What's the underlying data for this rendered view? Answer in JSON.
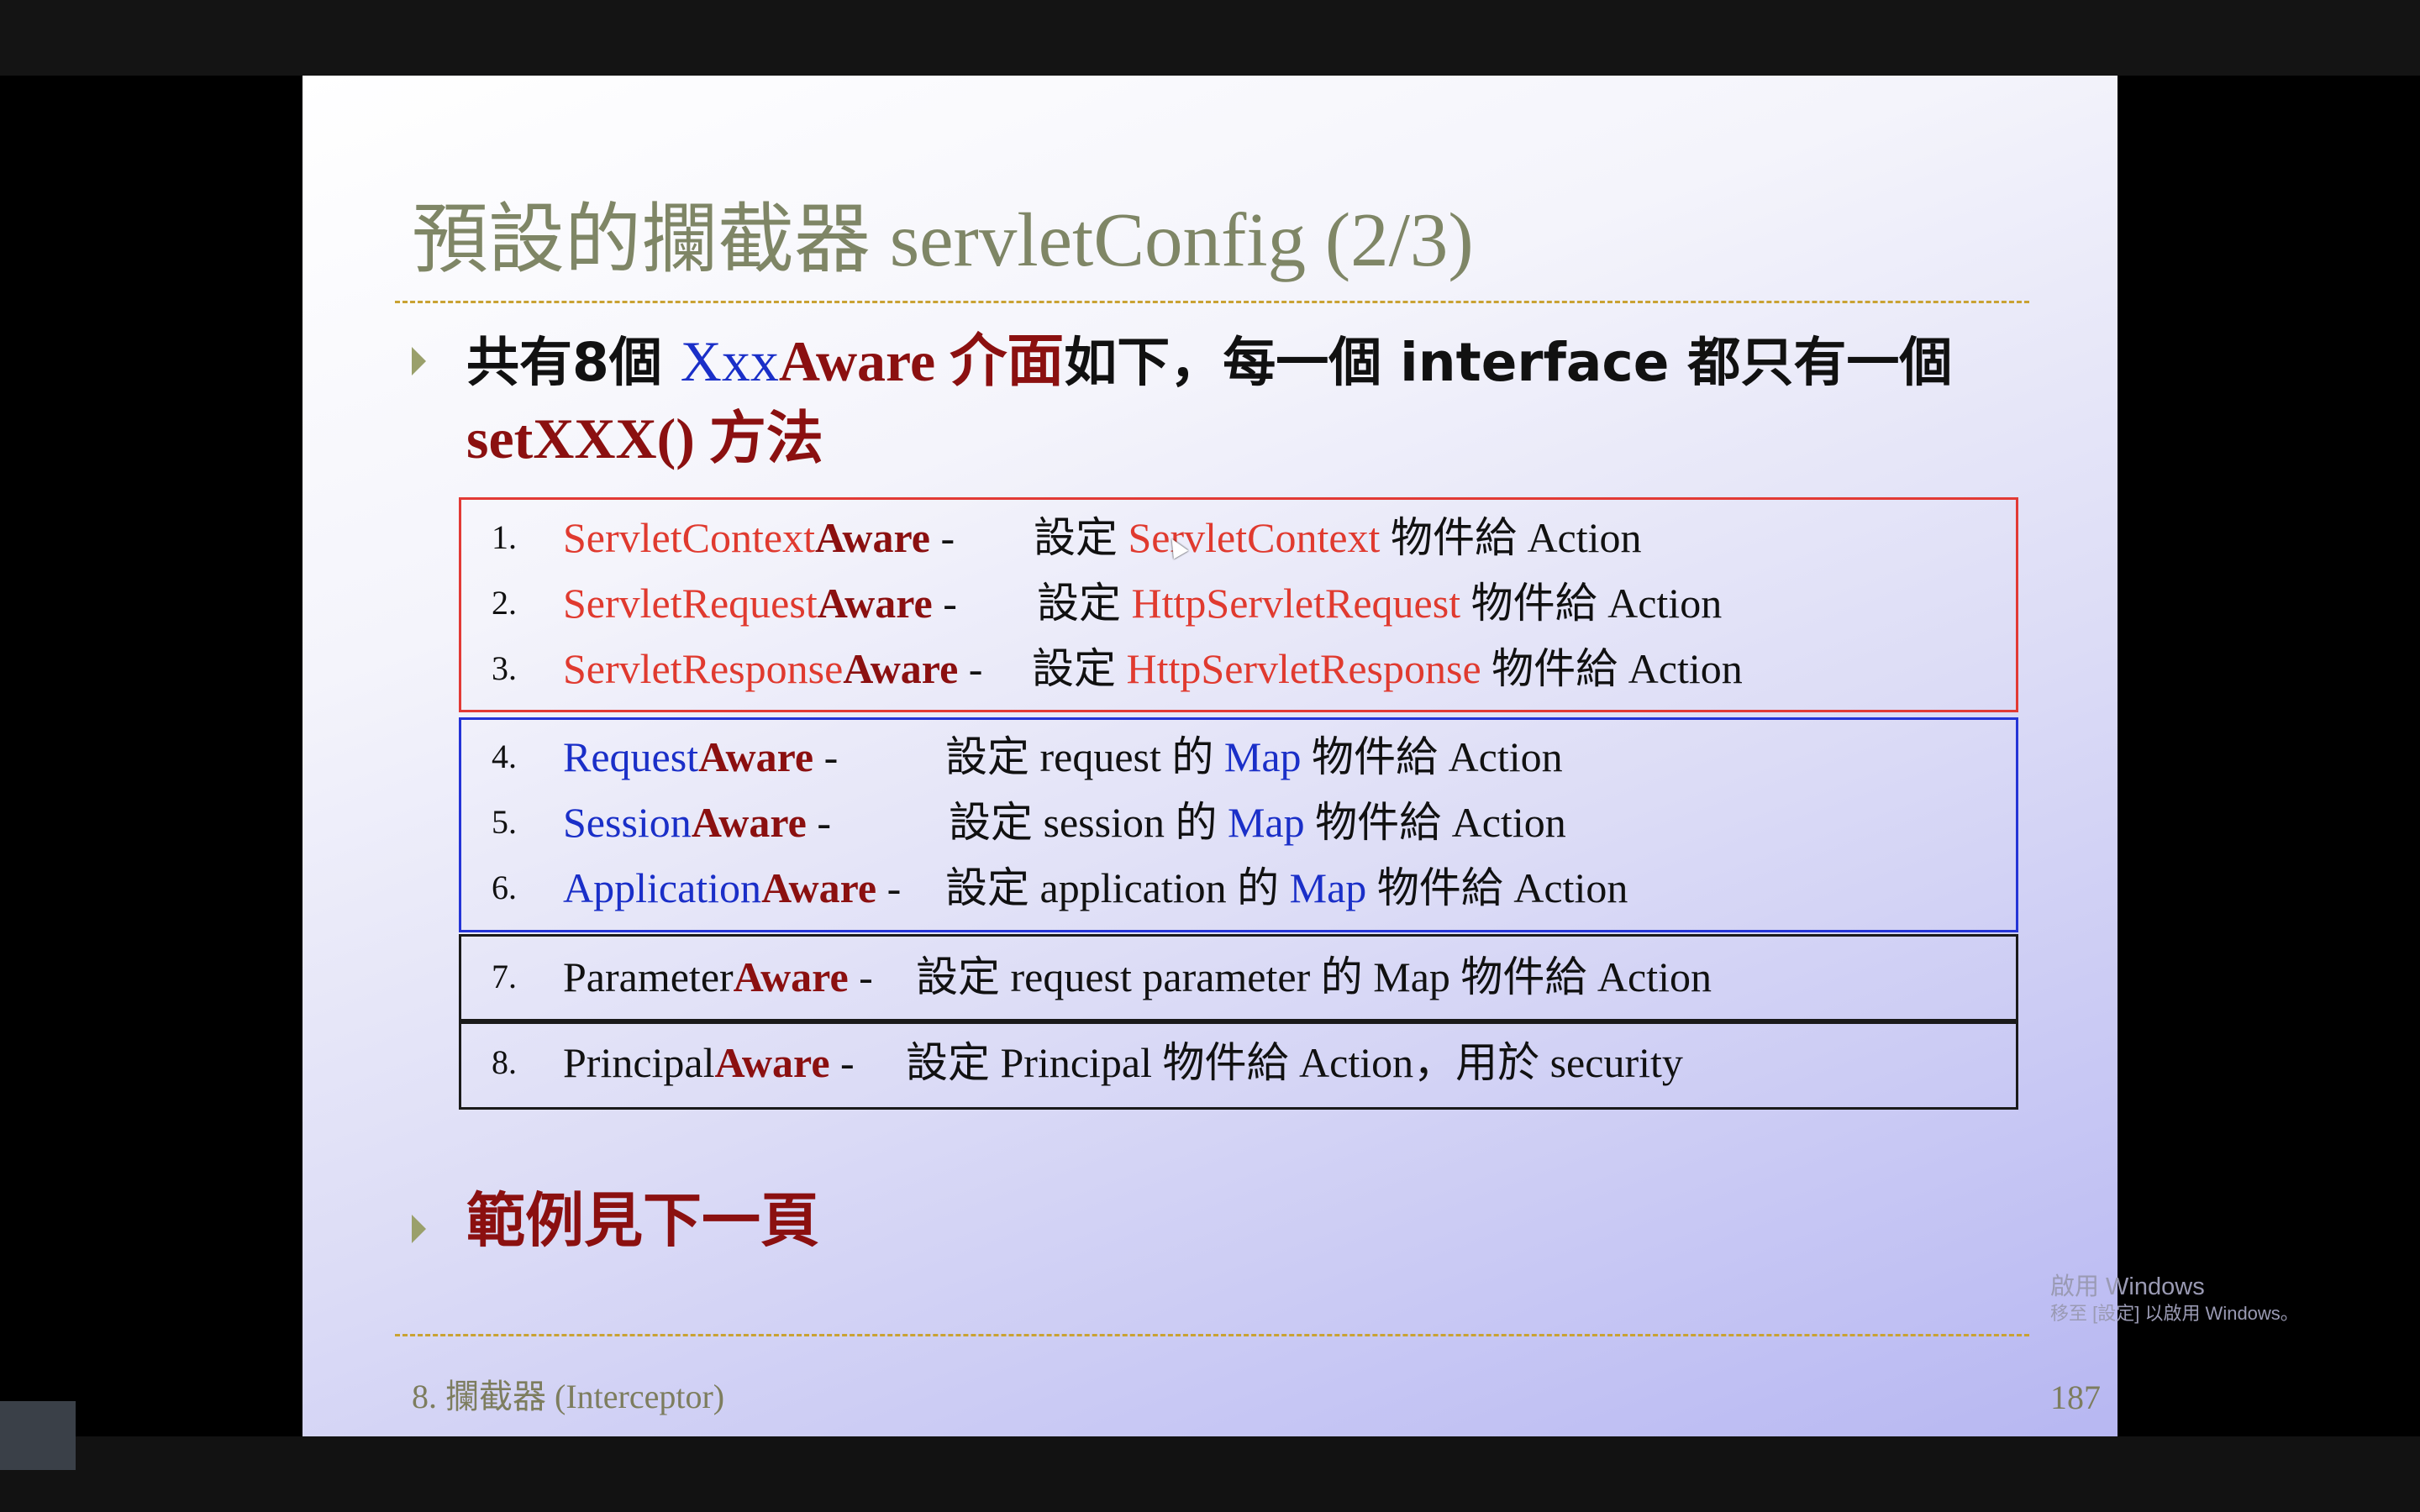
{
  "slide": {
    "title": "預設的攔截器 servletConfig (2/3)",
    "bullet1": {
      "p1": "共有8個 ",
      "p2": "Xxx",
      "p3": "Aware 介面",
      "p4": "如下，每一個 interface 都只有一個 ",
      "p5": "setXXX() 方法"
    },
    "items": [
      {
        "num": "1.",
        "pre": "Servlet",
        "pre2": "Context",
        "aware": "Aware",
        "dash": " -",
        "desc_a": "設定 ",
        "desc_b": "ServletContext",
        "desc_c": " 物件給 Action"
      },
      {
        "num": "2.",
        "pre": "Servlet",
        "pre2": "Request",
        "aware": "Aware",
        "dash": " -",
        "desc_a": "設定 ",
        "desc_b": "HttpServletRequest",
        "desc_c": " 物件給 Action"
      },
      {
        "num": "3.",
        "pre": "Servlet",
        "pre2": "Response",
        "aware": "Aware",
        "dash": " -",
        "desc_a": "設定 ",
        "desc_b": "HttpServletResponse",
        "desc_c": " 物件給 Action"
      },
      {
        "num": "4.",
        "pre": "Request",
        "aware": "Aware",
        "dash": " -",
        "desc_a": "設定 request 的 ",
        "desc_b": "Map",
        "desc_c": " 物件給 Action"
      },
      {
        "num": "5.",
        "pre": "Session",
        "aware": "Aware",
        "dash": " -",
        "desc_a": "設定 session 的 ",
        "desc_b": "Map",
        "desc_c": " 物件給 Action"
      },
      {
        "num": "6.",
        "pre": "Application",
        "aware": "Aware",
        "dash": " -",
        "desc_a": "設定 application 的 ",
        "desc_b": "Map",
        "desc_c": " 物件給 Action"
      },
      {
        "num": "7.",
        "pre": "Parameter",
        "aware": "Aware",
        "dash": " -",
        "desc": "設定 request parameter 的 Map 物件給 Action"
      },
      {
        "num": "8.",
        "pre": "Principal",
        "aware": "Aware",
        "dash": " -",
        "desc": "設定 Principal 物件給 Action，用於 security"
      }
    ],
    "bullet2": "範例見下一頁",
    "footer_chapter": "8.   攔截器 (Interceptor)",
    "page_number": "187"
  },
  "watermark": {
    "line1": "啟用 Windows",
    "line2": "移至 [設定] 以啟用 Windows。"
  },
  "colors": {
    "title": "#7f8666",
    "accent_red": "#e03a2f",
    "accent_blue": "#1a2fc8",
    "dark_red": "#8b1010",
    "dash": "#c9a233"
  }
}
